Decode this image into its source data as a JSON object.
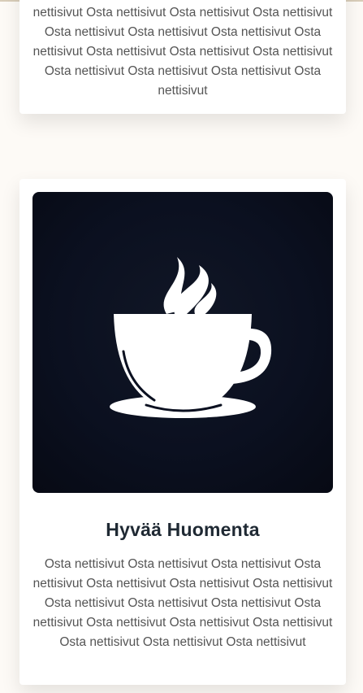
{
  "cards": [
    {
      "text": "nettisivut Osta nettisivut Osta nettisivut Osta nettisivut Osta nettisivut Osta nettisivut Osta nettisivut Osta nettisivut Osta nettisivut Osta nettisivut Osta nettisivut Osta nettisivut Osta nettisivut Osta nettisivut Osta nettisivut"
    },
    {
      "image_icon": "coffee-cup-icon",
      "title": "Hyvää Huomenta",
      "text": "Osta nettisivut Osta nettisivut Osta nettisivut Osta nettisivut Osta nettisivut Osta nettisivut Osta nettisivut Osta nettisivut Osta nettisivut Osta nettisivut Osta nettisivut Osta nettisivut Osta nettisivut Osta nettisivut Osta nettisivut Osta nettisivut Osta nettisivut"
    }
  ],
  "colors": {
    "page_background": "#fdfaf6",
    "card_background": "#ffffff",
    "image_background": "#0b1020",
    "title": "#1f2933",
    "body_text": "#555555"
  }
}
